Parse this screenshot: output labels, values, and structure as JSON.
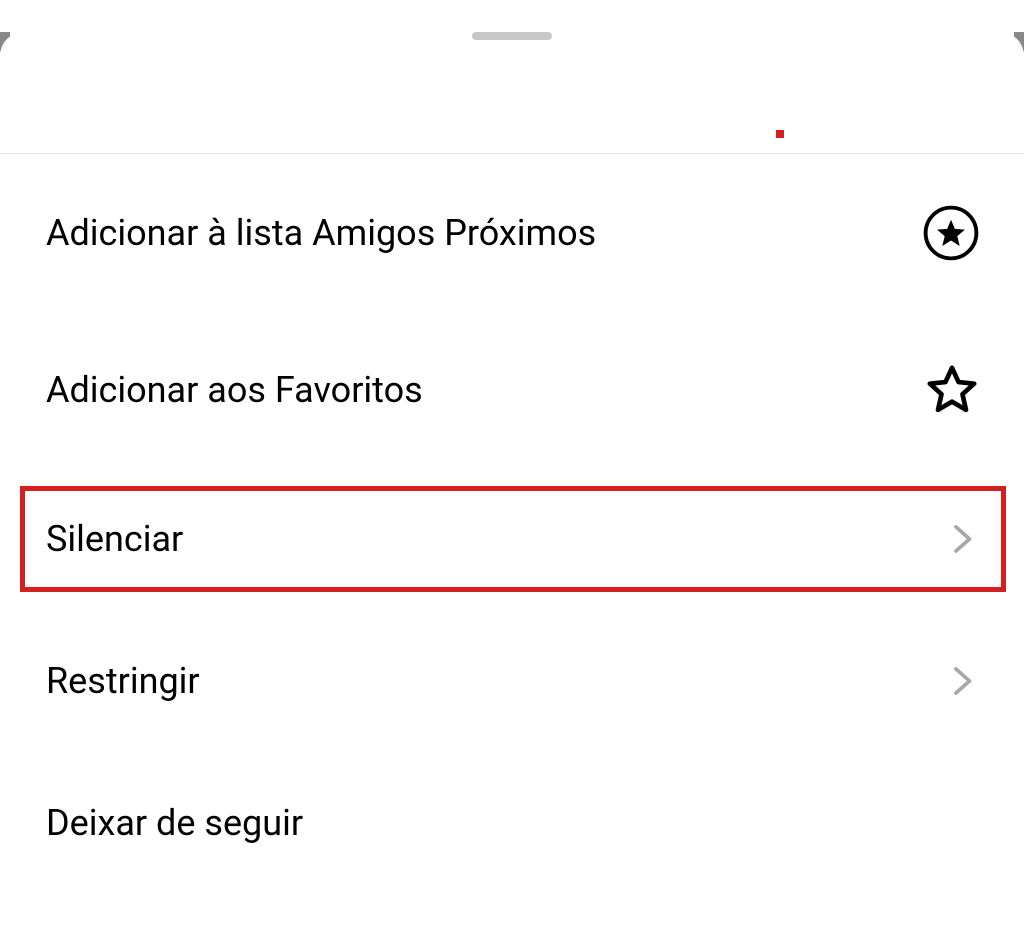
{
  "menu": {
    "items": [
      {
        "label": "Adicionar à lista Amigos Próximos",
        "icon": "star-circle"
      },
      {
        "label": "Adicionar aos Favoritos",
        "icon": "star-outline"
      },
      {
        "label": "Silenciar",
        "icon": "chevron",
        "highlighted": true
      },
      {
        "label": "Restringir",
        "icon": "chevron"
      },
      {
        "label": "Deixar de seguir",
        "icon": "none"
      }
    ]
  }
}
